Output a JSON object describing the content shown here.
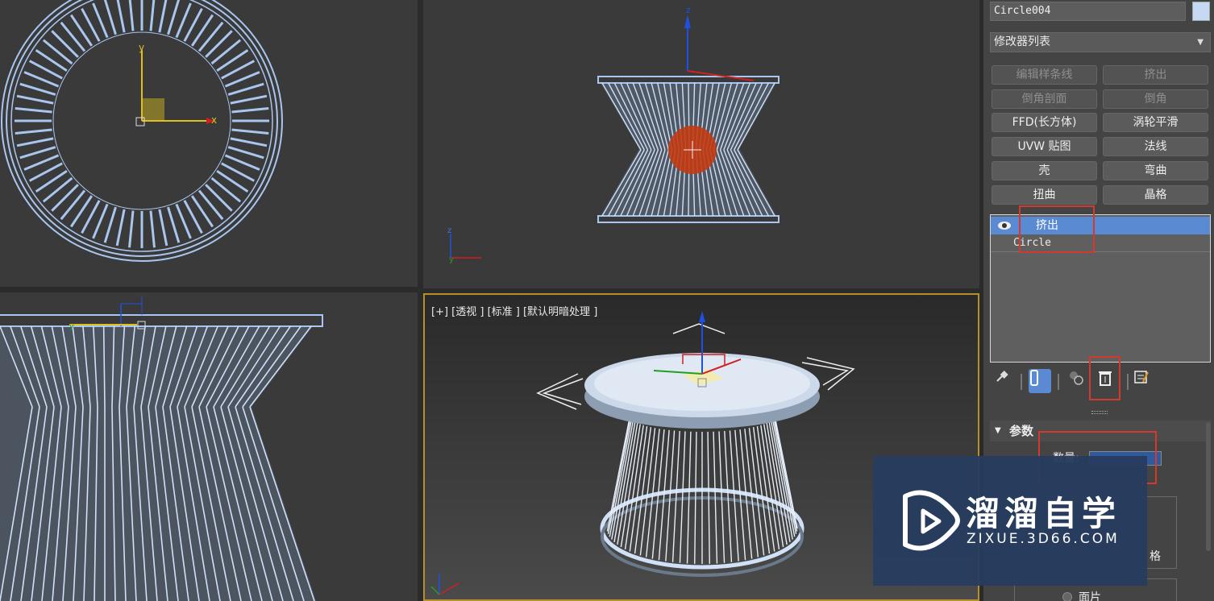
{
  "viewports": {
    "perspective_label": "[+] [透视 ] [标准 ] [默认明暗处理 ]"
  },
  "command_panel": {
    "object_name": "Circle004",
    "object_color": "#c7d9f2",
    "modifier_list_label": "修改器列表",
    "modifier_buttons": [
      {
        "label": "编辑样条线",
        "enabled": false
      },
      {
        "label": "挤出",
        "enabled": false
      },
      {
        "label": "倒角剖面",
        "enabled": false
      },
      {
        "label": "倒角",
        "enabled": false
      },
      {
        "label": "FFD(长方体)",
        "enabled": true
      },
      {
        "label": "涡轮平滑",
        "enabled": true
      },
      {
        "label": "UVW 贴图",
        "enabled": true
      },
      {
        "label": "法线",
        "enabled": true
      },
      {
        "label": "壳",
        "enabled": true
      },
      {
        "label": "弯曲",
        "enabled": true
      },
      {
        "label": "扭曲",
        "enabled": true
      },
      {
        "label": "晶格",
        "enabled": true
      }
    ],
    "stack": {
      "selected": "挤出",
      "base": "Circle"
    },
    "toolbar": [
      "pin-stack-icon",
      "show-end-result-icon",
      "make-unique-icon",
      "remove-modifier-icon",
      "configure-sets-icon"
    ],
    "parameters": {
      "rollout_title": "参数",
      "amount_label": "数量:",
      "bottom_option": "面片",
      "partial_option": "格"
    }
  },
  "watermark": {
    "title": "溜溜自学",
    "subtitle": "ZIXUE.3D66.COM"
  },
  "colors": {
    "selection_blue": "#5a8ad2",
    "highlight_red": "#d23a2e",
    "wireframe": "#a9c6ee",
    "active_viewport_border": "#b8902a"
  }
}
